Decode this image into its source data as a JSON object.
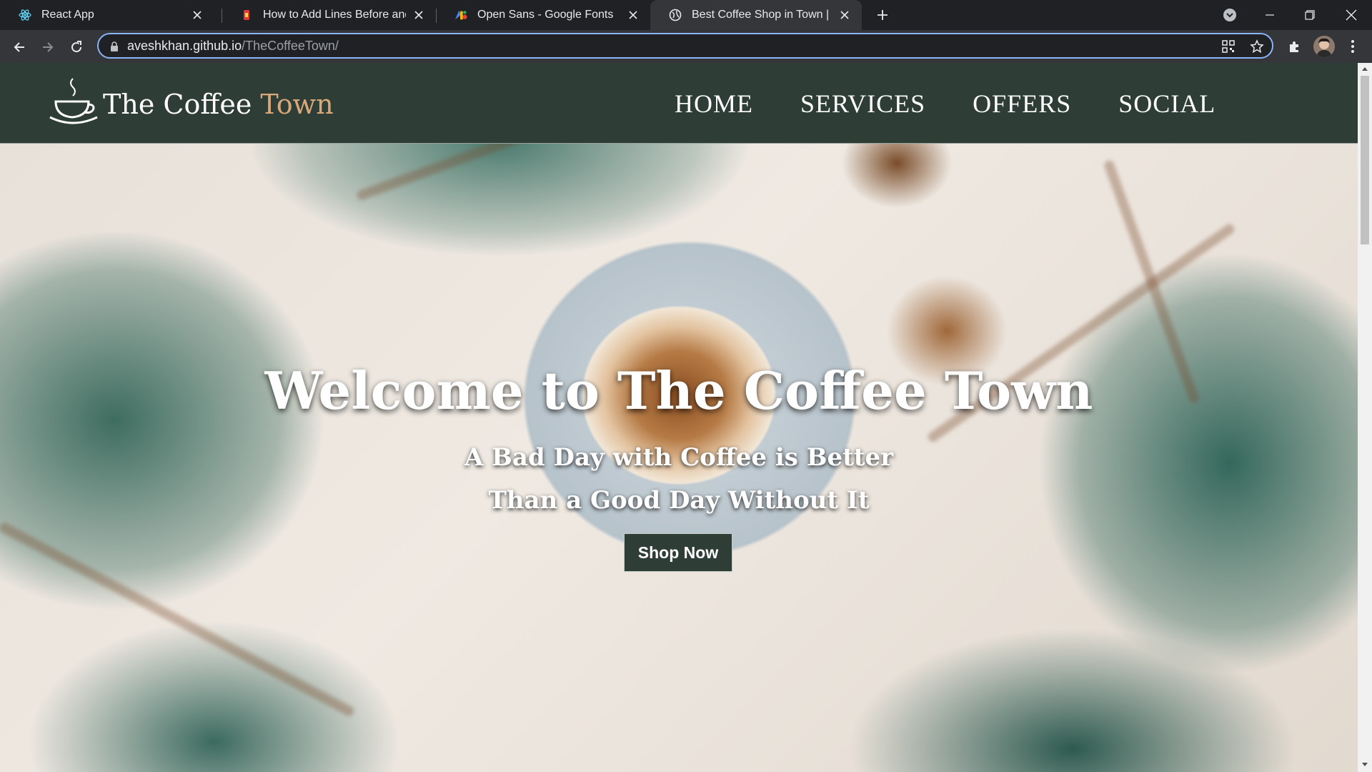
{
  "browser": {
    "tabs": [
      {
        "title": "React App",
        "favicon": "react-icon",
        "active": false
      },
      {
        "title": "How to Add Lines Before and After",
        "favicon": "site-favicon-icon",
        "active": false
      },
      {
        "title": "Open Sans - Google Fonts",
        "favicon": "google-fonts-icon",
        "active": false
      },
      {
        "title": "Best Coffee Shop in Town | www.",
        "favicon": "globe-icon",
        "active": true
      }
    ],
    "url_host": "aveshkhan.github.io",
    "url_path": "/TheCoffeeTown/",
    "accent_color": "#8ab4f8"
  },
  "site": {
    "logo_text_main": "The Coffee ",
    "logo_text_accent": "Town",
    "nav": [
      "HOME",
      "SERVICES",
      "OFFERS",
      "SOCIAL"
    ],
    "header_color": "#2e3e36",
    "accent_color": "#d9a878"
  },
  "hero": {
    "title": "Welcome to The Coffee Town",
    "subtitle_line1": "A Bad Day with Coffee is Better",
    "subtitle_line2": "Than a Good Day Without It",
    "button_label": "Shop Now"
  }
}
